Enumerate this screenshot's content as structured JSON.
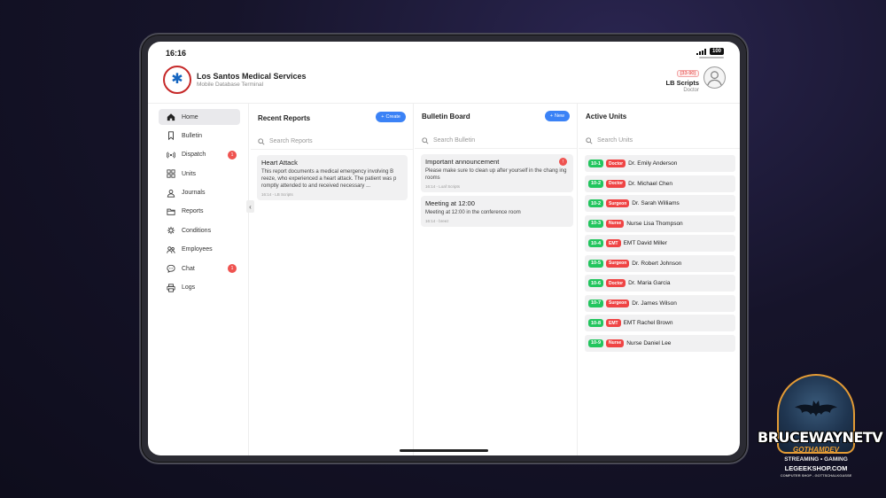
{
  "status": {
    "time": "16:16",
    "battery": "100"
  },
  "header": {
    "app_title": "Los Santos Medical Services",
    "app_subtitle": "Mobile Database Terminal",
    "user_badge": "[33-90]",
    "user_name": "LB Scripts",
    "user_role": "Doctor"
  },
  "sidebar": {
    "items": [
      {
        "label": "Home",
        "icon": "home-icon",
        "active": true
      },
      {
        "label": "Bulletin",
        "icon": "bookmark-icon"
      },
      {
        "label": "Dispatch",
        "icon": "broadcast-icon",
        "badge": "1"
      },
      {
        "label": "Units",
        "icon": "grid-icon"
      },
      {
        "label": "Journals",
        "icon": "user-icon"
      },
      {
        "label": "Reports",
        "icon": "folder-icon"
      },
      {
        "label": "Conditions",
        "icon": "virus-icon"
      },
      {
        "label": "Employees",
        "icon": "users-icon"
      },
      {
        "label": "Chat",
        "icon": "chat-icon",
        "badge": "1"
      },
      {
        "label": "Logs",
        "icon": "printer-icon"
      }
    ]
  },
  "reports": {
    "title": "Recent Reports",
    "create_label": "Create",
    "search_placeholder": "Search Reports",
    "items": [
      {
        "title": "Heart Attack",
        "body": "This report documents a medical emergency involving B reeze, who experienced a heart attack. The patient was p romptly attended to and received necessary ...",
        "meta": "16:14 - LB Scripts"
      }
    ]
  },
  "bulletin": {
    "title": "Bulletin Board",
    "new_label": "New",
    "search_placeholder": "Search Bulletin",
    "items": [
      {
        "title": "Important announcement",
        "body": "Please make sure to clean up after yourself in the chang ing rooms",
        "meta": "16:14 - Loaf Scripts",
        "badge": "!"
      },
      {
        "title": "Meeting at 12:00",
        "body": "Meeting at 12:00 in the conference room",
        "meta": "16:14 - breez"
      }
    ]
  },
  "units": {
    "title": "Active Units",
    "search_placeholder": "Search Units",
    "items": [
      {
        "id": "10-1",
        "role": "Doctor",
        "name": "Dr. Emily Anderson"
      },
      {
        "id": "10-2",
        "role": "Doctor",
        "name": "Dr. Michael Chen"
      },
      {
        "id": "10-2",
        "role": "Surgeon",
        "name": "Dr. Sarah Williams"
      },
      {
        "id": "10-3",
        "role": "Nurse",
        "name": "Nurse Lisa Thompson"
      },
      {
        "id": "10-4",
        "role": "EMT",
        "name": "EMT David Miller"
      },
      {
        "id": "10-5",
        "role": "Surgeon",
        "name": "Dr. Robert Johnson"
      },
      {
        "id": "10-6",
        "role": "Doctor",
        "name": "Dr. Maria Garcia"
      },
      {
        "id": "10-7",
        "role": "Surgeon",
        "name": "Dr. James Wilson"
      },
      {
        "id": "10-8",
        "role": "EMT",
        "name": "EMT Rachel Brown"
      },
      {
        "id": "10-9",
        "role": "Nurse",
        "name": "Nurse Daniel Lee"
      }
    ]
  },
  "colors": {
    "accent": "#3b82f6",
    "unit_id": "#22c55e",
    "role_badge": "#ef4444",
    "alert": "#ef5350"
  },
  "watermark": {
    "title": "BRUCEWAYNETV",
    "subtitle": "GOTHAMDEV",
    "line1": "STREAMING • GAMING",
    "line2": "LEGEEKSHOP.COM",
    "line3": "COMPUTER SHOP - GOTTSCHALKGASSE"
  }
}
